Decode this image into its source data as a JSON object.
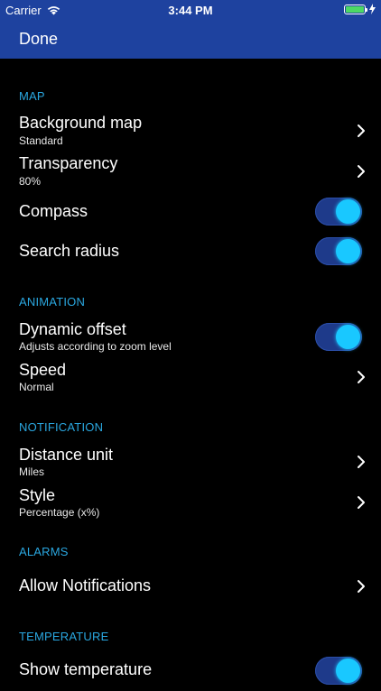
{
  "status": {
    "carrier": "Carrier",
    "time": "3:44 PM"
  },
  "nav": {
    "done_label": "Done"
  },
  "sections": {
    "map": {
      "header": "MAP",
      "background_map": {
        "title": "Background map",
        "value": "Standard"
      },
      "transparency": {
        "title": "Transparency",
        "value": "80%"
      },
      "compass": {
        "title": "Compass",
        "on": true
      },
      "search_radius": {
        "title": "Search radius",
        "on": true
      }
    },
    "animation": {
      "header": "ANIMATION",
      "dynamic_offset": {
        "title": "Dynamic offset",
        "subtitle": "Adjusts according to zoom level",
        "on": true
      },
      "speed": {
        "title": "Speed",
        "value": "Normal"
      }
    },
    "notification": {
      "header": "NOTIFICATION",
      "distance_unit": {
        "title": "Distance unit",
        "value": "Miles"
      },
      "style": {
        "title": "Style",
        "value": "Percentage (x%)"
      }
    },
    "alarms": {
      "header": "ALARMS",
      "allow_notifications": {
        "title": "Allow Notifications"
      }
    },
    "temperature": {
      "header": "TEMPERATURE",
      "show_temperature": {
        "title": "Show temperature",
        "on": true
      }
    }
  },
  "colors": {
    "bar": "#1e429f",
    "accent": "#2aa7e0",
    "toggle_knob": "#19c8ff"
  }
}
